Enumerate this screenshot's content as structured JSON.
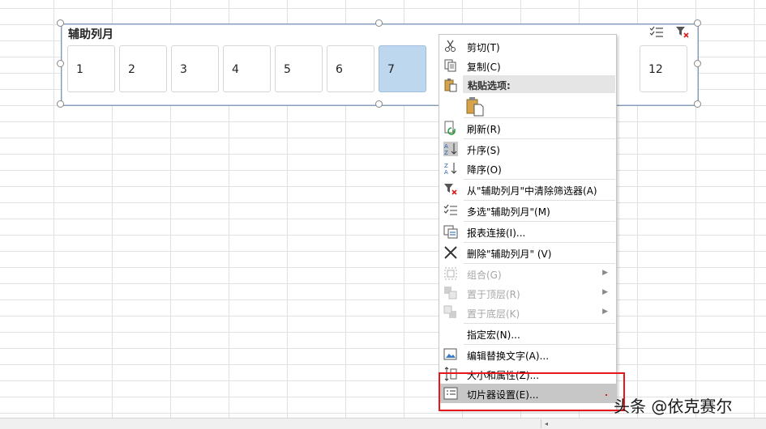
{
  "slicer": {
    "title": "辅助列月",
    "items": [
      {
        "label": "1",
        "selected": false
      },
      {
        "label": "2",
        "selected": false
      },
      {
        "label": "3",
        "selected": false
      },
      {
        "label": "4",
        "selected": false
      },
      {
        "label": "5",
        "selected": false
      },
      {
        "label": "6",
        "selected": false
      },
      {
        "label": "7",
        "selected": true
      },
      {
        "label": "12",
        "selected": false
      }
    ],
    "tools": {
      "multiselect_icon": "multi-select-icon",
      "clear_filter_icon": "clear-filter-icon"
    }
  },
  "context_menu": {
    "cut": "剪切(T)",
    "copy": "复制(C)",
    "paste_options": "粘贴选项:",
    "refresh": "刷新(R)",
    "sort_asc": "升序(S)",
    "sort_desc": "降序(O)",
    "clear_filter": "从\"辅助列月\"中清除筛选器(A)",
    "multi_select": "多选\"辅助列月\"(M)",
    "report_connections": "报表连接(I)...",
    "delete": "删除\"辅助列月\" (V)",
    "group": "组合(G)",
    "bring_to_front": "置于顶层(R)",
    "send_to_back": "置于底层(K)",
    "assign_macro": "指定宏(N)...",
    "edit_alt_text": "编辑替换文字(A)...",
    "size_properties": "大小和属性(Z)...",
    "slicer_settings": "切片器设置(E)..."
  },
  "colors": {
    "selected_item": "#bdd7ee",
    "highlight_row": "#c7c7c7",
    "annotation_box": "#e5191b"
  },
  "watermark": "头条 @依克赛尔"
}
